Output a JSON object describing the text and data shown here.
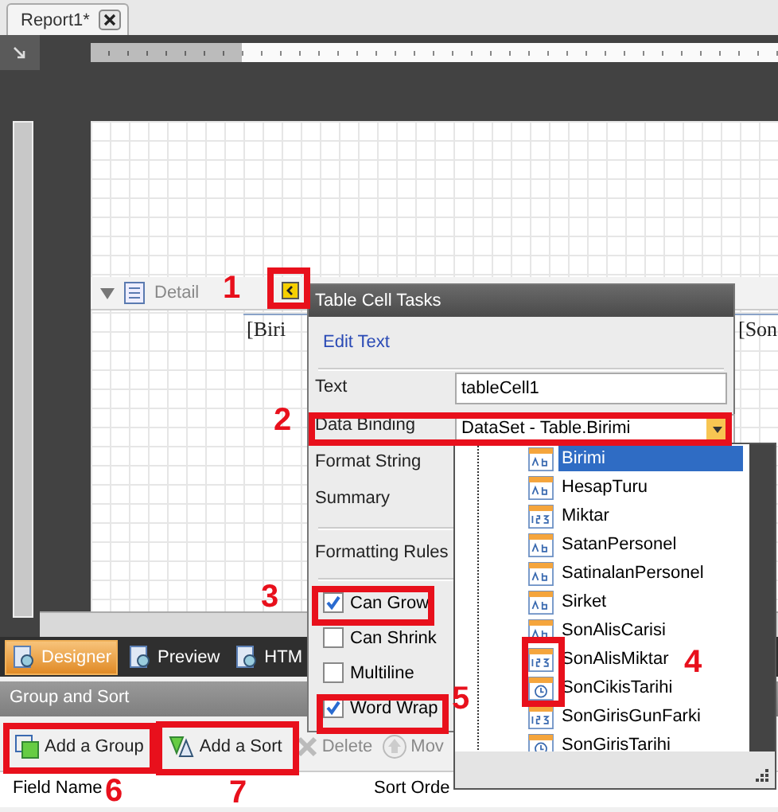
{
  "tabs": [
    {
      "label": "Report1*",
      "selected": true
    }
  ],
  "design_surface": {
    "band": "Detail",
    "cells": [
      "[Biri",
      "[Son"
    ]
  },
  "view_tabs": [
    {
      "label": "Designer",
      "selected": true
    },
    {
      "label": "Preview",
      "selected": false
    },
    {
      "label": "HTM",
      "selected": false
    }
  ],
  "group_sort": {
    "title": "Group and Sort",
    "toolbar": [
      {
        "label": "Add a Group",
        "disabled": false,
        "kind": "group"
      },
      {
        "label": "Add a Sort",
        "disabled": false,
        "kind": "sort"
      },
      {
        "label": "Delete",
        "disabled": true,
        "kind": "delete"
      },
      {
        "label": "Mov",
        "disabled": true,
        "kind": "move"
      }
    ],
    "columns": [
      "Field Name",
      "Sort Orde"
    ]
  },
  "tasks": {
    "title": "Table Cell Tasks",
    "link": "Edit Text",
    "fields": [
      {
        "label": "Text",
        "value": "tableCell1",
        "kind": "input"
      },
      {
        "label": "Data Binding",
        "value": "DataSet - Table.Birimi",
        "kind": "dropdown"
      },
      {
        "label": "Format String",
        "kind": "label"
      },
      {
        "label": "Summary",
        "kind": "label"
      },
      {
        "label": "Formatting Rules",
        "kind": "label"
      }
    ],
    "options": [
      {
        "label": "Can Grow",
        "checked": true
      },
      {
        "label": "Can Shrink",
        "checked": false
      },
      {
        "label": "Multiline",
        "checked": false
      },
      {
        "label": "Word Wrap",
        "checked": true
      }
    ]
  },
  "field_list": [
    {
      "name": "Birimi",
      "kind": "text",
      "selected": true
    },
    {
      "name": "HesapTuru",
      "kind": "text",
      "selected": false
    },
    {
      "name": "Miktar",
      "kind": "number",
      "selected": false
    },
    {
      "name": "SatanPersonel",
      "kind": "text",
      "selected": false
    },
    {
      "name": "SatinalanPersonel",
      "kind": "text",
      "selected": false
    },
    {
      "name": "Sirket",
      "kind": "text",
      "selected": false
    },
    {
      "name": "SonAlisCarisi",
      "kind": "text",
      "selected": false
    },
    {
      "name": "SonAlisMiktar",
      "kind": "number",
      "selected": false
    },
    {
      "name": "SonCikisTarihi",
      "kind": "date",
      "selected": false
    },
    {
      "name": "SonGirisGunFarki",
      "kind": "number",
      "selected": false
    },
    {
      "name": "SonGirisTarihi",
      "kind": "date",
      "selected": false
    }
  ],
  "annotations": [
    "1",
    "2",
    "3",
    "4",
    "5",
    "6",
    "7"
  ]
}
